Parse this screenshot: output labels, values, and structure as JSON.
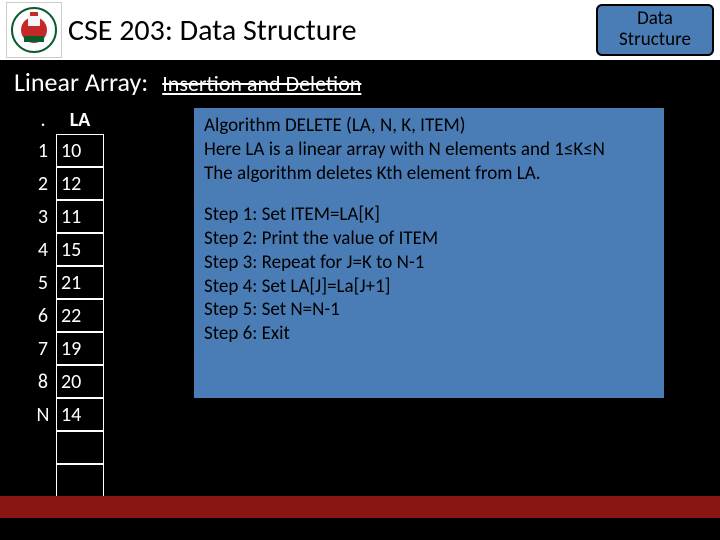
{
  "header": {
    "course_title": "CSE 203: Data Structure",
    "badge": "Data Structure"
  },
  "subheader": {
    "label": "Linear Array:",
    "topic": "Insertion and Deletion"
  },
  "array": {
    "idx_header": ".",
    "val_header": "LA",
    "rows": [
      {
        "idx": "1",
        "val": "10"
      },
      {
        "idx": "2",
        "val": "12"
      },
      {
        "idx": "3",
        "val": "11"
      },
      {
        "idx": "4",
        "val": "15"
      },
      {
        "idx": "5",
        "val": "21"
      },
      {
        "idx": "6",
        "val": "22"
      },
      {
        "idx": "7",
        "val": "19"
      },
      {
        "idx": "8",
        "val": "20"
      },
      {
        "idx": "N",
        "val": "14"
      },
      {
        "idx": "",
        "val": ""
      },
      {
        "idx": "",
        "val": ""
      }
    ]
  },
  "algorithm": {
    "line1": "Algorithm DELETE (LA, N, K, ITEM)",
    "line2": "Here LA is a linear array with N elements and 1≤K≤N",
    "line3": "The algorithm deletes Kth element from LA.",
    "step1": "Step 1: Set ITEM=LA[K]",
    "step2": "Step 2: Print the value of ITEM",
    "step3": "Step 3: Repeat for J=K to N-1",
    "step4": "Step 4: Set LA[J]=La[J+1]",
    "step5": "Step 5: Set N=N-1",
    "step6": "Step 6: Exit"
  }
}
